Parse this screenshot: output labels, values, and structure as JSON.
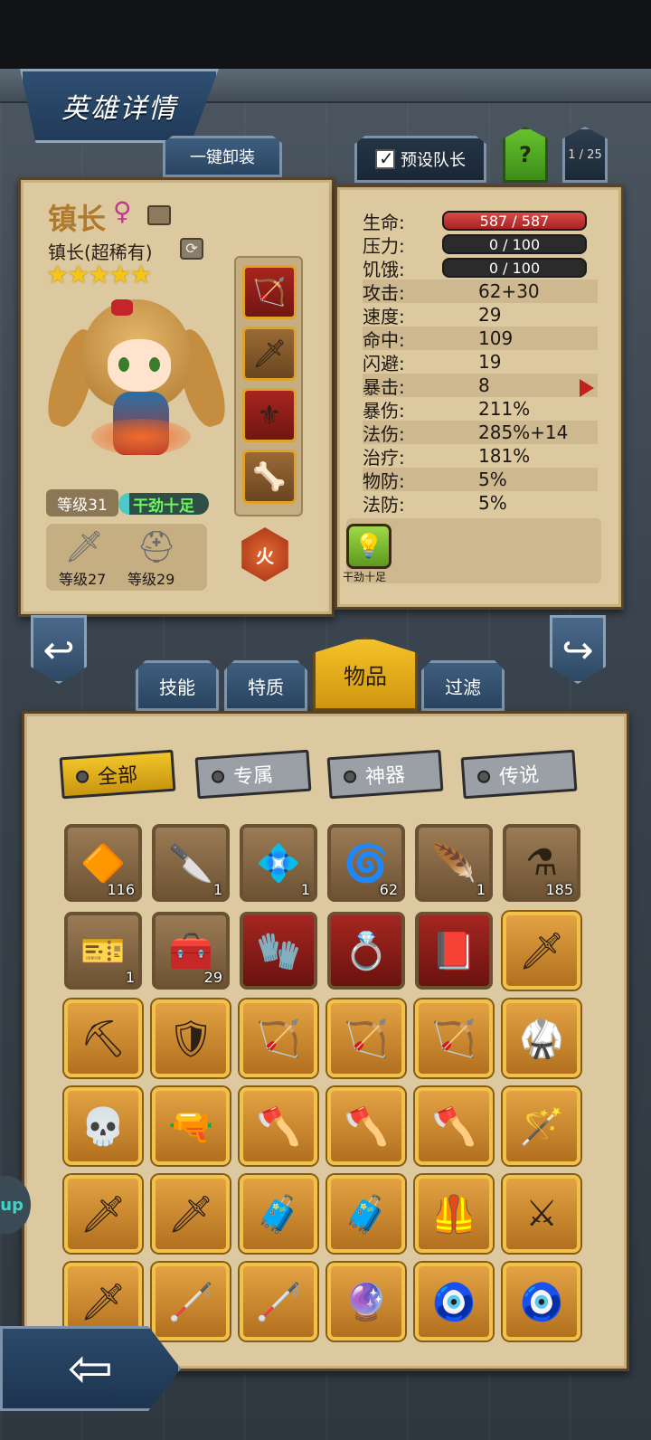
{
  "header": {
    "title": "英雄详情"
  },
  "toolbar": {
    "unequip_label": "一键卸装",
    "leader_label": "预设队长",
    "help_label": "?",
    "page_indicator": "1 / 25"
  },
  "hero": {
    "name": "镇长",
    "class_label": "镇长(超稀有)",
    "stars": "★★★★★",
    "level": "等级31",
    "mood": "干劲十足",
    "element": "火",
    "weapon_level": "等级27",
    "armor_level": "等级29"
  },
  "stats": [
    {
      "label": "生命:",
      "value": "587 / 587"
    },
    {
      "label": "压力:",
      "value": "0 / 100"
    },
    {
      "label": "饥饿:",
      "value": "0 / 100"
    },
    {
      "label": "攻击:",
      "value": "62+30"
    },
    {
      "label": "速度:",
      "value": "29"
    },
    {
      "label": "命中:",
      "value": "109"
    },
    {
      "label": "闪避:",
      "value": "19"
    },
    {
      "label": "暴击:",
      "value": "8"
    },
    {
      "label": "暴伤:",
      "value": "211%"
    },
    {
      "label": "法伤:",
      "value": "285%+14"
    },
    {
      "label": "治疗:",
      "value": "181%"
    },
    {
      "label": "物防:",
      "value": "5%"
    },
    {
      "label": "法防:",
      "value": "5%"
    }
  ],
  "trait": {
    "label": "干劲十足"
  },
  "tabs": [
    {
      "label": "技能"
    },
    {
      "label": "特质"
    },
    {
      "label": "物品"
    },
    {
      "label": "过滤"
    }
  ],
  "filters": [
    {
      "label": "全部"
    },
    {
      "label": "专属"
    },
    {
      "label": "神器"
    },
    {
      "label": "传说"
    }
  ],
  "items": {
    "counts": [
      "116",
      "1",
      "1",
      "62",
      "1",
      "185",
      "1",
      "29"
    ]
  },
  "side_tab": {
    "label": "up"
  }
}
